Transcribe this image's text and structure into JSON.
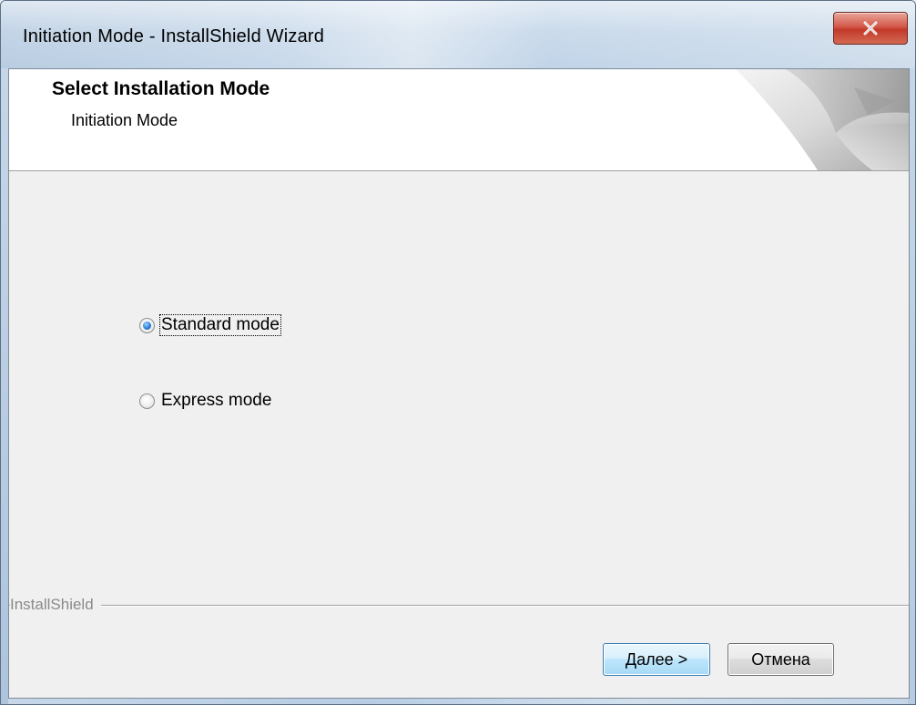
{
  "window": {
    "title": "Initiation Mode - InstallShield Wizard"
  },
  "header": {
    "title": "Select Installation Mode",
    "subtitle": "Initiation Mode"
  },
  "options": [
    {
      "label": "Standard mode",
      "selected": true
    },
    {
      "label": "Express mode",
      "selected": false
    }
  ],
  "footer": {
    "brand": "InstallShield",
    "next_label_accel": "Д",
    "next_label_rest": "алее >",
    "cancel_label": "Отмена"
  },
  "colors": {
    "accent": "#3c7fb1",
    "close": "#c3392a",
    "dialog_bg": "#f0f0f0"
  },
  "icons": {
    "close": "close-icon",
    "radio_selected": "radio-selected-icon",
    "radio_unselected": "radio-unselected-icon"
  }
}
